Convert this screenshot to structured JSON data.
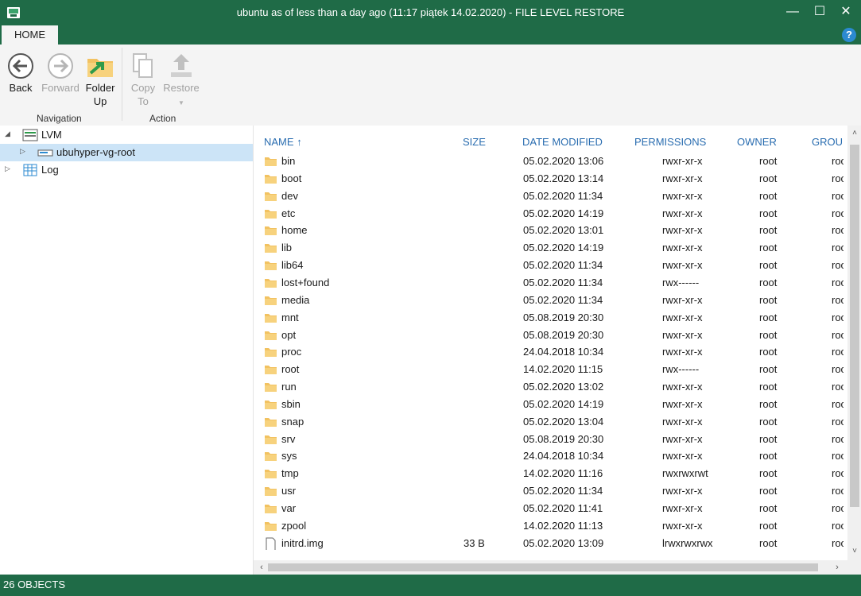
{
  "window": {
    "title": "ubuntu as of less than a day ago (11:17 piątek 14.02.2020) - FILE LEVEL RESTORE",
    "minimize_label": "—",
    "maximize_label": "☐",
    "close_label": "✕"
  },
  "ribbon": {
    "tab": "HOME",
    "help_label": "?",
    "back_label": "Back",
    "forward_label": "Forward",
    "folder_up_label_1": "Folder",
    "folder_up_label_2": "Up",
    "copy_label_1": "Copy",
    "copy_label_2": "To",
    "restore_label": "Restore",
    "navigation_group": "Navigation",
    "action_group": "Action"
  },
  "tree": {
    "items": [
      {
        "label": "LVM"
      },
      {
        "label": "ubuhyper-vg-root"
      },
      {
        "label": "Log"
      }
    ]
  },
  "list": {
    "columns": {
      "name": "NAME",
      "size": "SIZE",
      "date": "DATE MODIFIED",
      "permissions": "PERMISSIONS",
      "owner": "OWNER",
      "group": "GROUP"
    },
    "rows": [
      {
        "name": "bin",
        "size": "",
        "date": "05.02.2020 13:06",
        "perm": "rwxr-xr-x",
        "owner": "root",
        "group": "root"
      },
      {
        "name": "boot",
        "size": "",
        "date": "05.02.2020 13:14",
        "perm": "rwxr-xr-x",
        "owner": "root",
        "group": "root"
      },
      {
        "name": "dev",
        "size": "",
        "date": "05.02.2020 11:34",
        "perm": "rwxr-xr-x",
        "owner": "root",
        "group": "root"
      },
      {
        "name": "etc",
        "size": "",
        "date": "05.02.2020 14:19",
        "perm": "rwxr-xr-x",
        "owner": "root",
        "group": "root"
      },
      {
        "name": "home",
        "size": "",
        "date": "05.02.2020 13:01",
        "perm": "rwxr-xr-x",
        "owner": "root",
        "group": "root"
      },
      {
        "name": "lib",
        "size": "",
        "date": "05.02.2020 14:19",
        "perm": "rwxr-xr-x",
        "owner": "root",
        "group": "root"
      },
      {
        "name": "lib64",
        "size": "",
        "date": "05.02.2020 11:34",
        "perm": "rwxr-xr-x",
        "owner": "root",
        "group": "root"
      },
      {
        "name": "lost+found",
        "size": "",
        "date": "05.02.2020 11:34",
        "perm": "rwx------",
        "owner": "root",
        "group": "root"
      },
      {
        "name": "media",
        "size": "",
        "date": "05.02.2020 11:34",
        "perm": "rwxr-xr-x",
        "owner": "root",
        "group": "root"
      },
      {
        "name": "mnt",
        "size": "",
        "date": "05.08.2019 20:30",
        "perm": "rwxr-xr-x",
        "owner": "root",
        "group": "root"
      },
      {
        "name": "opt",
        "size": "",
        "date": "05.08.2019 20:30",
        "perm": "rwxr-xr-x",
        "owner": "root",
        "group": "root"
      },
      {
        "name": "proc",
        "size": "",
        "date": "24.04.2018 10:34",
        "perm": "rwxr-xr-x",
        "owner": "root",
        "group": "root"
      },
      {
        "name": "root",
        "size": "",
        "date": "14.02.2020 11:15",
        "perm": "rwx------",
        "owner": "root",
        "group": "root"
      },
      {
        "name": "run",
        "size": "",
        "date": "05.02.2020 13:02",
        "perm": "rwxr-xr-x",
        "owner": "root",
        "group": "root"
      },
      {
        "name": "sbin",
        "size": "",
        "date": "05.02.2020 14:19",
        "perm": "rwxr-xr-x",
        "owner": "root",
        "group": "root"
      },
      {
        "name": "snap",
        "size": "",
        "date": "05.02.2020 13:04",
        "perm": "rwxr-xr-x",
        "owner": "root",
        "group": "root"
      },
      {
        "name": "srv",
        "size": "",
        "date": "05.08.2019 20:30",
        "perm": "rwxr-xr-x",
        "owner": "root",
        "group": "root"
      },
      {
        "name": "sys",
        "size": "",
        "date": "24.04.2018 10:34",
        "perm": "rwxr-xr-x",
        "owner": "root",
        "group": "root"
      },
      {
        "name": "tmp",
        "size": "",
        "date": "14.02.2020 11:16",
        "perm": "rwxrwxrwt",
        "owner": "root",
        "group": "root"
      },
      {
        "name": "usr",
        "size": "",
        "date": "05.02.2020 11:34",
        "perm": "rwxr-xr-x",
        "owner": "root",
        "group": "root"
      },
      {
        "name": "var",
        "size": "",
        "date": "05.02.2020 11:41",
        "perm": "rwxr-xr-x",
        "owner": "root",
        "group": "root"
      },
      {
        "name": "zpool",
        "size": "",
        "date": "14.02.2020 11:13",
        "perm": "rwxr-xr-x",
        "owner": "root",
        "group": "root"
      },
      {
        "name": "initrd.img",
        "size": "33 B",
        "date": "05.02.2020 13:09",
        "perm": "lrwxrwxrwx",
        "owner": "root",
        "group": "root"
      }
    ]
  },
  "status": {
    "objects": "26 OBJECTS"
  },
  "colors": {
    "brand_green": "#1f6b47",
    "folder": "#f2c261",
    "header_blue": "#2a6db0",
    "selection": "#cce4f7"
  },
  "icons": {
    "app": "restore-app-icon",
    "back": "back-arrow-icon",
    "forward": "forward-arrow-icon",
    "folder_up": "folder-up-icon",
    "copy": "copy-icon",
    "restore": "restore-icon",
    "folder": "folder-icon",
    "file": "file-icon",
    "sort": "sort-ascending-icon"
  }
}
